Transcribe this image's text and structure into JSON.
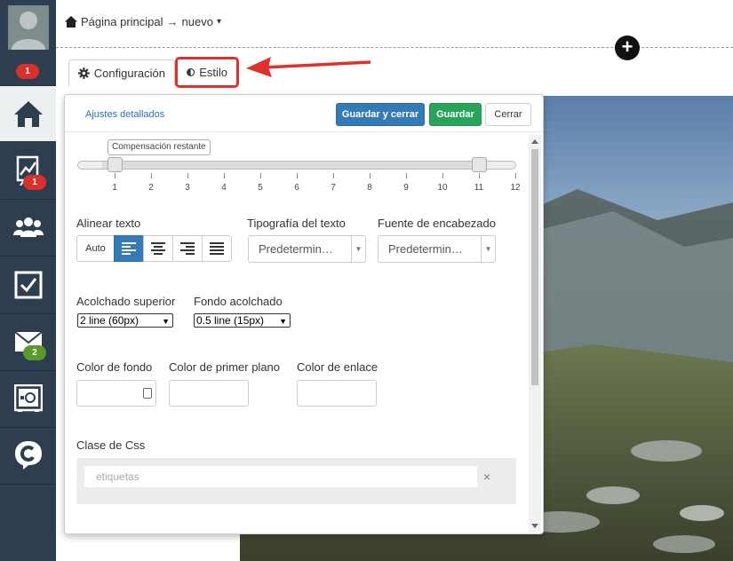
{
  "sidebar": {
    "badges": {
      "top": "1",
      "reports": "1",
      "mail": "2"
    },
    "items": [
      "avatar",
      "home",
      "reports",
      "users",
      "tasks",
      "mail",
      "safe",
      "app"
    ]
  },
  "breadcrumb": {
    "home": "Página principal",
    "arrow": "→",
    "current": "nuevo",
    "caret": "▾"
  },
  "add_button": "+",
  "tabs": {
    "config": "Configuración",
    "style": "Estilo"
  },
  "panel": {
    "advanced_link": "Ajustes detallados",
    "save_close": "Guardar y cerrar",
    "save": "Guardar",
    "close": "Cerrar",
    "slider": {
      "tooltip": "Compensación restante",
      "ticks": [
        "1",
        "2",
        "3",
        "4",
        "5",
        "6",
        "7",
        "8",
        "9",
        "10",
        "11",
        "12"
      ],
      "start": 1,
      "end": 11
    },
    "align_label": "Alinear texto",
    "align_auto": "Auto",
    "font_label": "Tipografía del texto",
    "font_value": "Predetermin…",
    "heading_font_label": "Fuente de encabezado",
    "heading_font_value": "Predetermin…",
    "padding_top_label": "Acolchado superior",
    "padding_top_value": "2 line (60px)",
    "padding_bottom_label": "Fondo acolchado",
    "padding_bottom_value": "0.5 line (15px)",
    "bg_color_label": "Color de fondo",
    "fg_color_label": "Color de primer plano",
    "link_color_label": "Color de enlace",
    "css_class_label": "Clase de Css",
    "tags_placeholder": "etiquetas",
    "tags_clear": "×"
  },
  "colors": {
    "primary": "#337ab7",
    "success": "#27a35a",
    "highlight": "#e0302a",
    "sidebar": "#2c3e50"
  }
}
